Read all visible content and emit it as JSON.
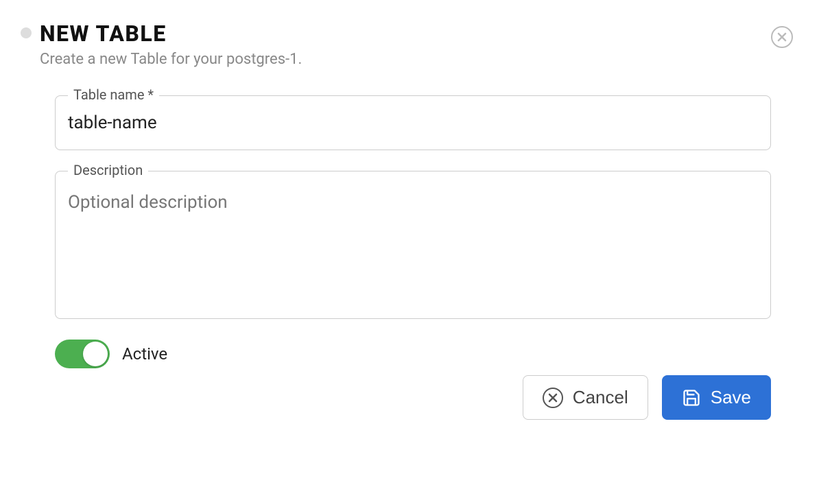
{
  "header": {
    "title": "NEW TABLE",
    "subtitle": "Create a new Table for your postgres-1."
  },
  "form": {
    "table_name": {
      "label": "Table name *",
      "value": "table-name"
    },
    "description": {
      "label": "Description",
      "placeholder": "Optional description",
      "value": ""
    },
    "active": {
      "label": "Active",
      "checked": true
    }
  },
  "buttons": {
    "cancel": "Cancel",
    "save": "Save"
  },
  "colors": {
    "toggle_on": "#4caf50",
    "primary": "#2d71d6"
  }
}
